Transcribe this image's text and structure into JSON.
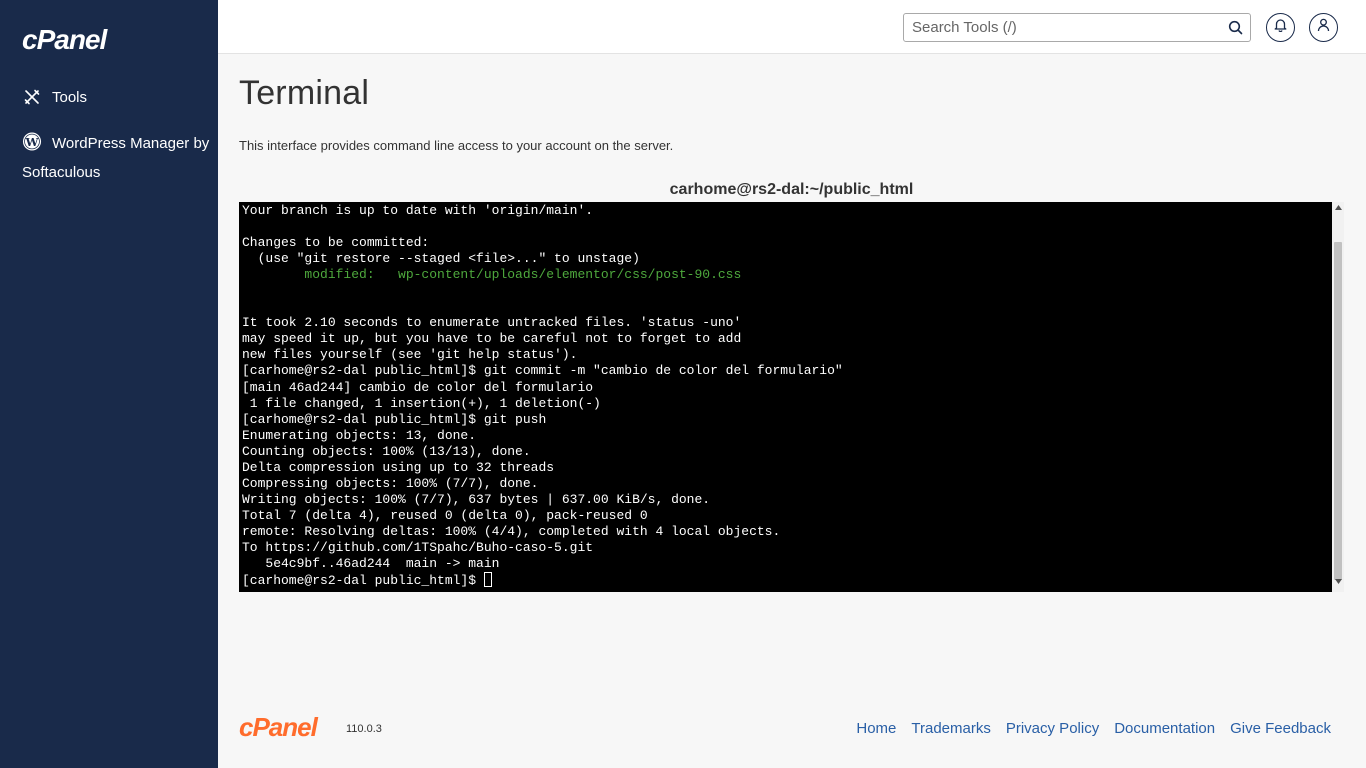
{
  "sidebar": {
    "logo": "cPanel",
    "items": [
      {
        "label": "Tools",
        "icon": "tools-icon"
      },
      {
        "label": "WordPress Manager by Softaculous",
        "icon": "wordpress-icon"
      }
    ]
  },
  "header": {
    "search": {
      "placeholder": "Search Tools (/)",
      "value": ""
    },
    "icons": [
      "search-icon",
      "bell-icon",
      "user-icon"
    ]
  },
  "main": {
    "title": "Terminal",
    "description": "This interface provides command line access to your account on the server.",
    "terminal": {
      "title": "carhome@rs2-dal:~/public_html",
      "lines": [
        {
          "text": "Your branch is up to date with 'origin/main'.",
          "color": "default"
        },
        {
          "text": "",
          "color": "default"
        },
        {
          "text": "Changes to be committed:",
          "color": "default"
        },
        {
          "text": "  (use \"git restore --staged <file>...\" to unstage)",
          "color": "default"
        },
        {
          "text": "        modified:   wp-content/uploads/elementor/css/post-90.css",
          "color": "green"
        },
        {
          "text": "",
          "color": "default"
        },
        {
          "text": "",
          "color": "default"
        },
        {
          "text": "It took 2.10 seconds to enumerate untracked files. 'status -uno'",
          "color": "default"
        },
        {
          "text": "may speed it up, but you have to be careful not to forget to add",
          "color": "default"
        },
        {
          "text": "new files yourself (see 'git help status').",
          "color": "default"
        },
        {
          "text": "[carhome@rs2-dal public_html]$ git commit -m \"cambio de color del formulario\"",
          "color": "default"
        },
        {
          "text": "[main 46ad244] cambio de color del formulario",
          "color": "default"
        },
        {
          "text": " 1 file changed, 1 insertion(+), 1 deletion(-)",
          "color": "default"
        },
        {
          "text": "[carhome@rs2-dal public_html]$ git push",
          "color": "default"
        },
        {
          "text": "Enumerating objects: 13, done.",
          "color": "default"
        },
        {
          "text": "Counting objects: 100% (13/13), done.",
          "color": "default"
        },
        {
          "text": "Delta compression using up to 32 threads",
          "color": "default"
        },
        {
          "text": "Compressing objects: 100% (7/7), done.",
          "color": "default"
        },
        {
          "text": "Writing objects: 100% (7/7), 637 bytes | 637.00 KiB/s, done.",
          "color": "default"
        },
        {
          "text": "Total 7 (delta 4), reused 0 (delta 0), pack-reused 0",
          "color": "default"
        },
        {
          "text": "remote: Resolving deltas: 100% (4/4), completed with 4 local objects.",
          "color": "default"
        },
        {
          "text": "To https://github.com/1TSpahc/Buho-caso-5.git",
          "color": "default"
        },
        {
          "text": "   5e4c9bf..46ad244  main -> main",
          "color": "default"
        }
      ],
      "prompt": "[carhome@rs2-dal public_html]$ "
    }
  },
  "footer": {
    "logo": "cPanel",
    "version": "110.0.3",
    "links": [
      "Home",
      "Trademarks",
      "Privacy Policy",
      "Documentation",
      "Give Feedback"
    ]
  },
  "colors": {
    "sidebar_bg": "#192a4a",
    "brand_orange": "#ff6c2c",
    "link_blue": "#295fa6",
    "terminal_bg": "#000000",
    "terminal_green": "#4ea83d"
  }
}
